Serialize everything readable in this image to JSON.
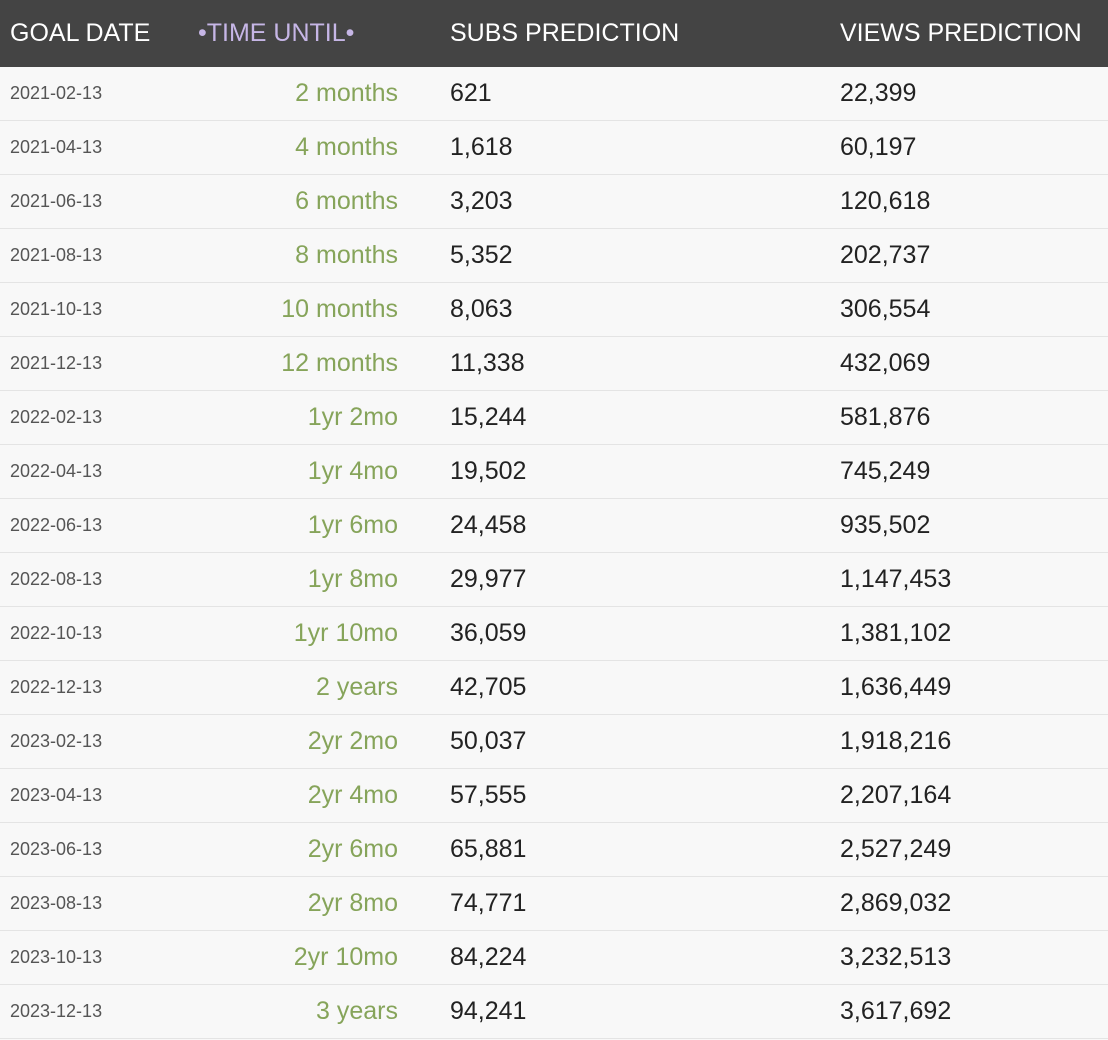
{
  "header": {
    "goal_date": "GOAL DATE",
    "time_until": "•TIME UNTIL•",
    "subs_prediction": "SUBS PREDICTION",
    "views_prediction": "VIEWS PREDICTION"
  },
  "colors": {
    "header_bg": "#444444",
    "header_text": "#ffffff",
    "sorted_header_text": "#c6b6e6",
    "time_until_text": "#86a45a",
    "row_bg": "#f8f8f8"
  },
  "rows": [
    {
      "date": "2021-02-13",
      "time": "2 months",
      "subs": "621",
      "views": "22,399"
    },
    {
      "date": "2021-04-13",
      "time": "4 months",
      "subs": "1,618",
      "views": "60,197"
    },
    {
      "date": "2021-06-13",
      "time": "6 months",
      "subs": "3,203",
      "views": "120,618"
    },
    {
      "date": "2021-08-13",
      "time": "8 months",
      "subs": "5,352",
      "views": "202,737"
    },
    {
      "date": "2021-10-13",
      "time": "10 months",
      "subs": "8,063",
      "views": "306,554"
    },
    {
      "date": "2021-12-13",
      "time": "12 months",
      "subs": "11,338",
      "views": "432,069"
    },
    {
      "date": "2022-02-13",
      "time": "1yr 2mo",
      "subs": "15,244",
      "views": "581,876"
    },
    {
      "date": "2022-04-13",
      "time": "1yr 4mo",
      "subs": "19,502",
      "views": "745,249"
    },
    {
      "date": "2022-06-13",
      "time": "1yr 6mo",
      "subs": "24,458",
      "views": "935,502"
    },
    {
      "date": "2022-08-13",
      "time": "1yr 8mo",
      "subs": "29,977",
      "views": "1,147,453"
    },
    {
      "date": "2022-10-13",
      "time": "1yr 10mo",
      "subs": "36,059",
      "views": "1,381,102"
    },
    {
      "date": "2022-12-13",
      "time": "2 years",
      "subs": "42,705",
      "views": "1,636,449"
    },
    {
      "date": "2023-02-13",
      "time": "2yr 2mo",
      "subs": "50,037",
      "views": "1,918,216"
    },
    {
      "date": "2023-04-13",
      "time": "2yr 4mo",
      "subs": "57,555",
      "views": "2,207,164"
    },
    {
      "date": "2023-06-13",
      "time": "2yr 6mo",
      "subs": "65,881",
      "views": "2,527,249"
    },
    {
      "date": "2023-08-13",
      "time": "2yr 8mo",
      "subs": "74,771",
      "views": "2,869,032"
    },
    {
      "date": "2023-10-13",
      "time": "2yr 10mo",
      "subs": "84,224",
      "views": "3,232,513"
    },
    {
      "date": "2023-12-13",
      "time": "3 years",
      "subs": "94,241",
      "views": "3,617,692"
    }
  ]
}
